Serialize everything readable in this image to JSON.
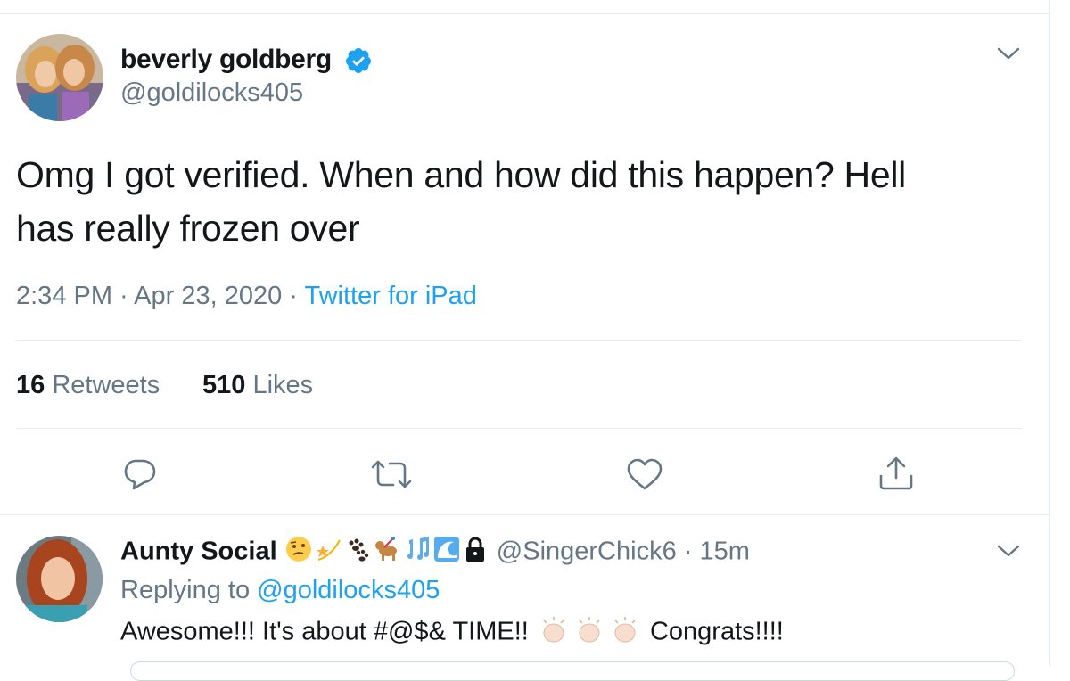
{
  "tweet": {
    "author_name": "beverly goldberg",
    "author_handle": "@goldilocks405",
    "text_line1": "Omg I got verified. When and how did this happen?  Hell",
    "text_line2": "has really frozen over",
    "time": "2:34 PM",
    "date": "Apr 23, 2020",
    "source": "Twitter for iPad",
    "retweet_count": "16",
    "retweet_label": "Retweets",
    "like_count": "510",
    "like_label": "Likes",
    "verified": true
  },
  "actions": {
    "icons": [
      "reply-icon",
      "retweet-icon",
      "like-icon",
      "share-icon"
    ]
  },
  "reply": {
    "author_name": "Aunty Social",
    "author_handle": "@SingerChick6",
    "time": "15m",
    "replying_label": "Replying to",
    "replying_to": "@goldilocks405",
    "text_part1": "Awesome!!! It's about #@$& TIME!!",
    "text_part2": "Congrats!!!!"
  },
  "colors": {
    "accent": "#1da1f2",
    "text": "#14171a",
    "muted": "#657786",
    "divider": "#e6ecf0"
  }
}
